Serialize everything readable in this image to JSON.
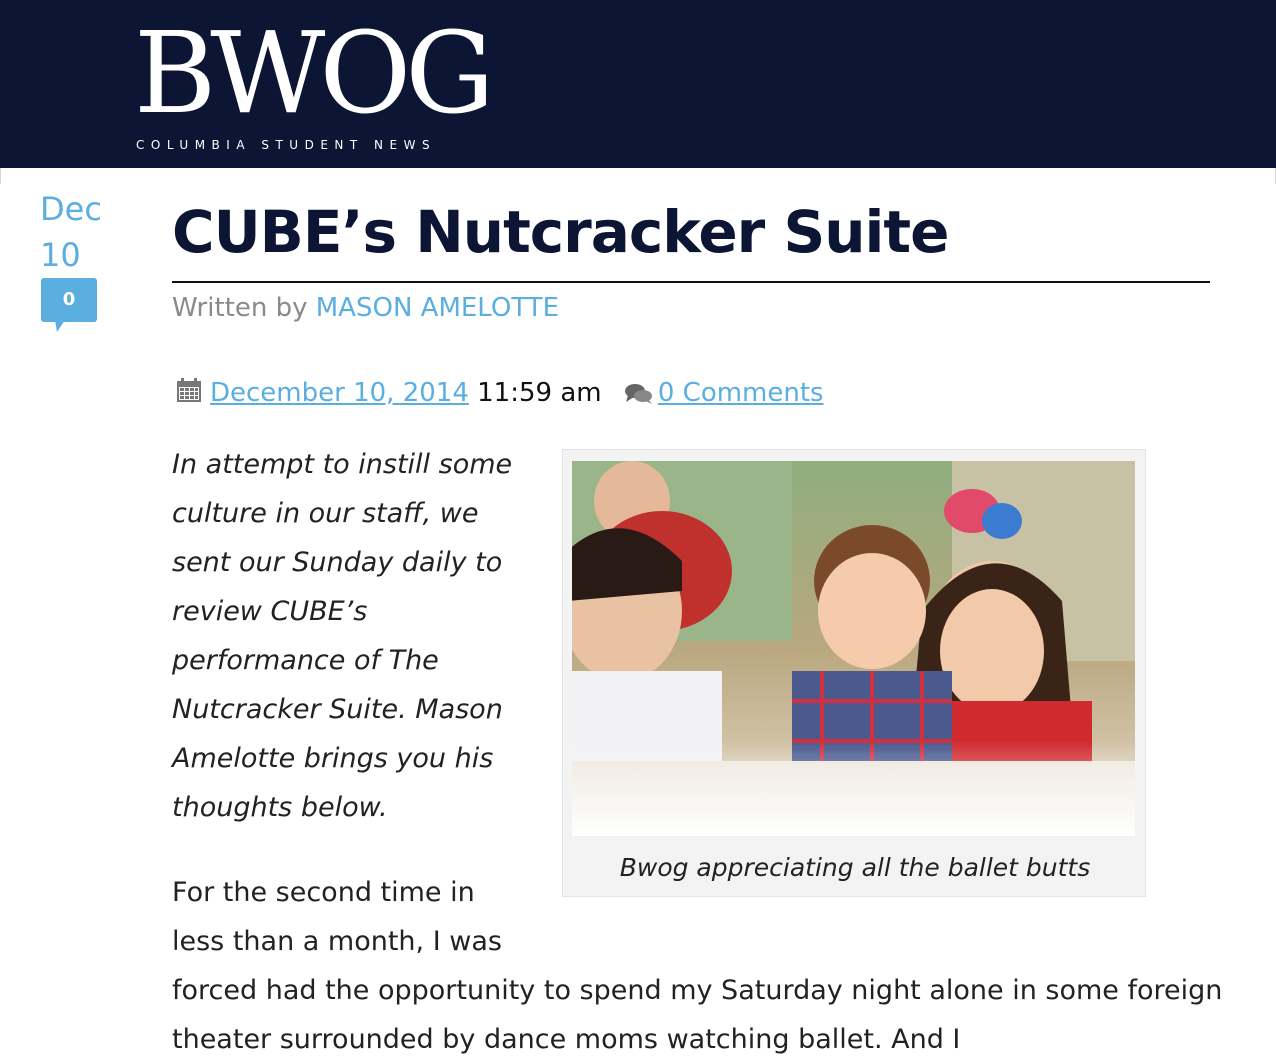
{
  "site": {
    "logo_text": "BWOG",
    "tagline": "COLUMBIA STUDENT NEWS",
    "brand_color": "#0c1533",
    "accent_color": "#5aaee0"
  },
  "post_date": {
    "month": "Dec",
    "day": "10"
  },
  "comments_badge": {
    "count": "0"
  },
  "article": {
    "title": "CUBE’s Nutcracker Suite",
    "byline_prefix": "Written by",
    "author": "MASON AMELOTTE",
    "date_link": "December 10, 2014",
    "time": "11:59 am",
    "comments_link": "0 Comments",
    "calendar_icon": "calendar-icon",
    "comments_icon": "chat-bubbles-icon",
    "intro": "In attempt to instill some culture in our staff, we sent our Sunday daily to review CUBE’s performance of The Nutcracker Suite. Mason Amelotte brings you his thoughts below.",
    "figure_caption": "Bwog appreciating all the ballet butts",
    "body_part1": "For the second time in less than a month, I was",
    "body_part2": "forced had the opportunity to spend my Saturday night alone in some foreign theater surrounded by dance moms watching ballet. And I"
  }
}
